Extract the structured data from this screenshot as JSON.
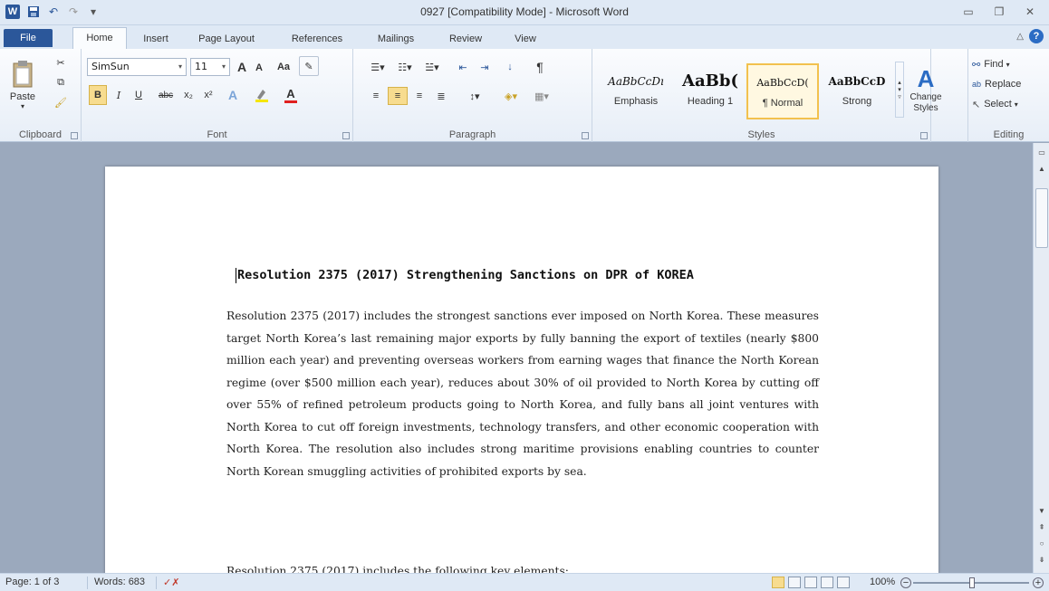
{
  "window": {
    "title": "0927 [Compatibility Mode] - Microsoft Word"
  },
  "qat": {
    "logo_letter": "W",
    "save_icon": "save-icon",
    "undo_icon": "undo-icon",
    "redo_icon": "redo-icon",
    "customize_icon": "customize-icon"
  },
  "tabs": [
    "File",
    "Home",
    "Insert",
    "Page Layout",
    "References",
    "Mailings",
    "Review",
    "View"
  ],
  "ribbon": {
    "clipboard": {
      "label": "Clipboard",
      "paste_label": "Paste"
    },
    "font": {
      "label": "Font",
      "font_name": "SimSun",
      "font_size": "11",
      "case_label": "Aa",
      "bold": "B",
      "italic": "I",
      "underline": "U",
      "strike": "abc",
      "subscript": "x₂",
      "superscript": "x²",
      "grow": "A",
      "shrink": "A"
    },
    "paragraph": {
      "label": "Paragraph",
      "pilcrow": "¶"
    },
    "styles": {
      "label": "Styles",
      "items": [
        {
          "sample": "AaBbCcDı",
          "name": "Emphasis"
        },
        {
          "sample": "AaBb(",
          "name": "Heading 1"
        },
        {
          "sample": "AaBbCcD(",
          "name": "¶ Normal"
        },
        {
          "sample": "AaBbCcD",
          "name": "Strong"
        }
      ],
      "change_styles": "Change Styles"
    },
    "editing": {
      "label": "Editing",
      "find": "Find",
      "replace": "Replace",
      "select": "Select"
    }
  },
  "document": {
    "title": "Resolution 2375 (2017) Strengthening Sanctions on DPR of KOREA",
    "paragraph1": "Resolution 2375 (2017) includes the strongest sanctions ever imposed on North Korea. These measures target North Korea’s last remaining major exports by fully banning the export of textiles (nearly $800 million each year) and preventing overseas workers from earning wages that finance the North Korean regime (over $500 million each year), reduces about 30% of oil provided to North Korea by cutting off over 55% of refined petroleum products going to North Korea, and fully bans all joint ventures with North Korea to cut off foreign investments, technology transfers, and other economic cooperation with North Korea. The resolution also includes strong maritime provisions enabling countries to counter North Korean smuggling activities of prohibited exports by sea.",
    "paragraph2": "Resolution 2375 (2017) includes the following key elements:"
  },
  "statusbar": {
    "page": "Page: 1 of 3",
    "words": "Words: 683",
    "zoom": "100%",
    "zoom_minus": "−",
    "zoom_plus": "+"
  },
  "colors": {
    "accent": "#2b579a",
    "ribbon_bg": "#e7eef7",
    "doc_bg": "#9ba9bd",
    "selected_style_border": "#f2c14e"
  }
}
